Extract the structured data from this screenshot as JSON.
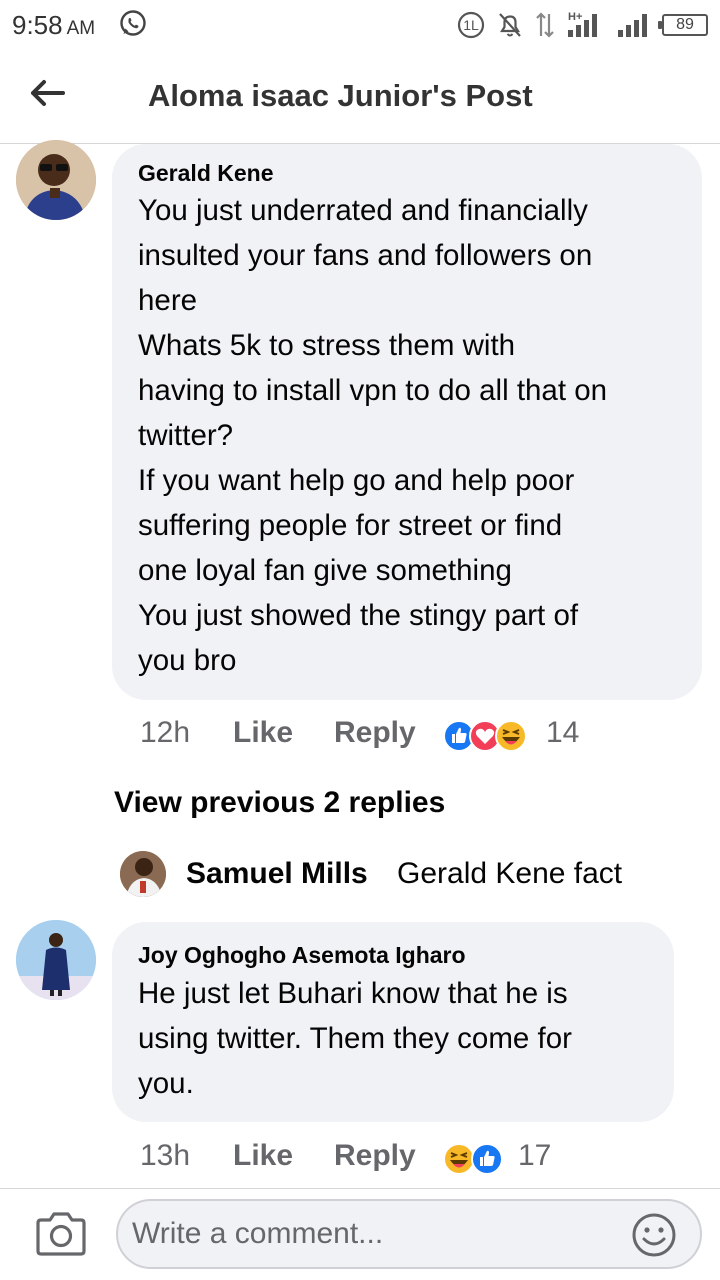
{
  "status_bar": {
    "time": "9:58",
    "ampm": "AM",
    "battery": "89"
  },
  "header": {
    "title": "Aloma isaac Junior's Post"
  },
  "comments": [
    {
      "author": "Gerald Kene",
      "lines": [
        "You just underrated and financially",
        "insulted your fans and followers on",
        "here",
        "Whats 5k to stress them with",
        "having to install vpn to do all that on",
        "twitter?",
        "If you want help go and  help poor",
        "suffering  people for  street or find",
        "one loyal fan give something",
        "You just showed the stingy part of",
        "you bro"
      ],
      "time": "12h",
      "like_label": "Like",
      "reply_label": "Reply",
      "reactions": [
        "like",
        "love",
        "haha"
      ],
      "reaction_count": "14"
    },
    {
      "author": "Joy Oghogho Asemota Igharo",
      "lines": [
        "He just let Buhari know that he is",
        "using twitter. Them they come for",
        "you."
      ],
      "time": "13h",
      "like_label": "Like",
      "reply_label": "Reply",
      "reactions": [
        "haha",
        "like"
      ],
      "reaction_count": "17"
    }
  ],
  "view_previous": "View previous 2 replies",
  "reply_preview": {
    "author": "Samuel Mills",
    "text": "Gerald Kene fact"
  },
  "composer": {
    "placeholder": "Write a comment..."
  },
  "colors": {
    "bubble": "#f0f2f5",
    "secondary_text": "#65676b",
    "like_blue": "#1877f2",
    "love_red": "#f33e58",
    "haha_yellow": "#f7b928"
  }
}
